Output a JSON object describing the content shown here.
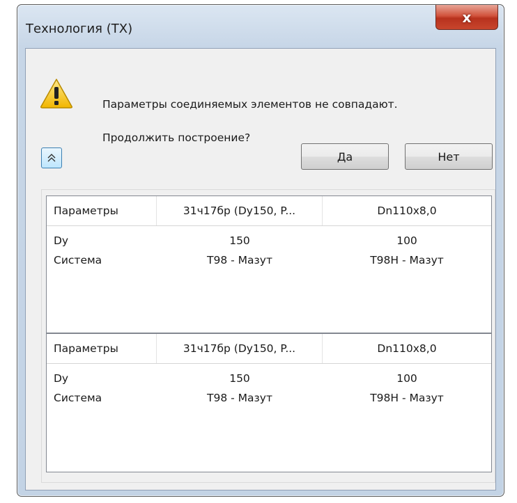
{
  "window": {
    "title": "Технология (ТХ)",
    "close_label": "x"
  },
  "message": {
    "line1": "Параметры соединяемых элементов не совпадают.",
    "line2": "Продолжить построение?",
    "icon": "warning-icon"
  },
  "buttons": {
    "toggle_icon": "chevron-double-up-icon",
    "yes": "Да",
    "no": "Нет"
  },
  "tables": [
    {
      "headers": [
        "Параметры",
        "31ч17бр (Dy150, P...",
        "Dn110x8,0"
      ],
      "rows": [
        [
          "Dy",
          "150",
          "100"
        ],
        [
          "Система",
          "Т98 - Мазут",
          "Т98Н - Мазут"
        ]
      ]
    },
    {
      "headers": [
        "Параметры",
        "31ч17бр (Dy150, P...",
        "Dn110x8,0"
      ],
      "rows": [
        [
          "Dy",
          "150",
          "100"
        ],
        [
          "Система",
          "Т98 - Мазут",
          "Т98Н - Мазут"
        ]
      ]
    }
  ],
  "colors": {
    "title_bar": "#c7d6e7",
    "close_button": "#c7452c",
    "warning_fill": "#f5c400",
    "toggle_button": "#bee6fd"
  }
}
